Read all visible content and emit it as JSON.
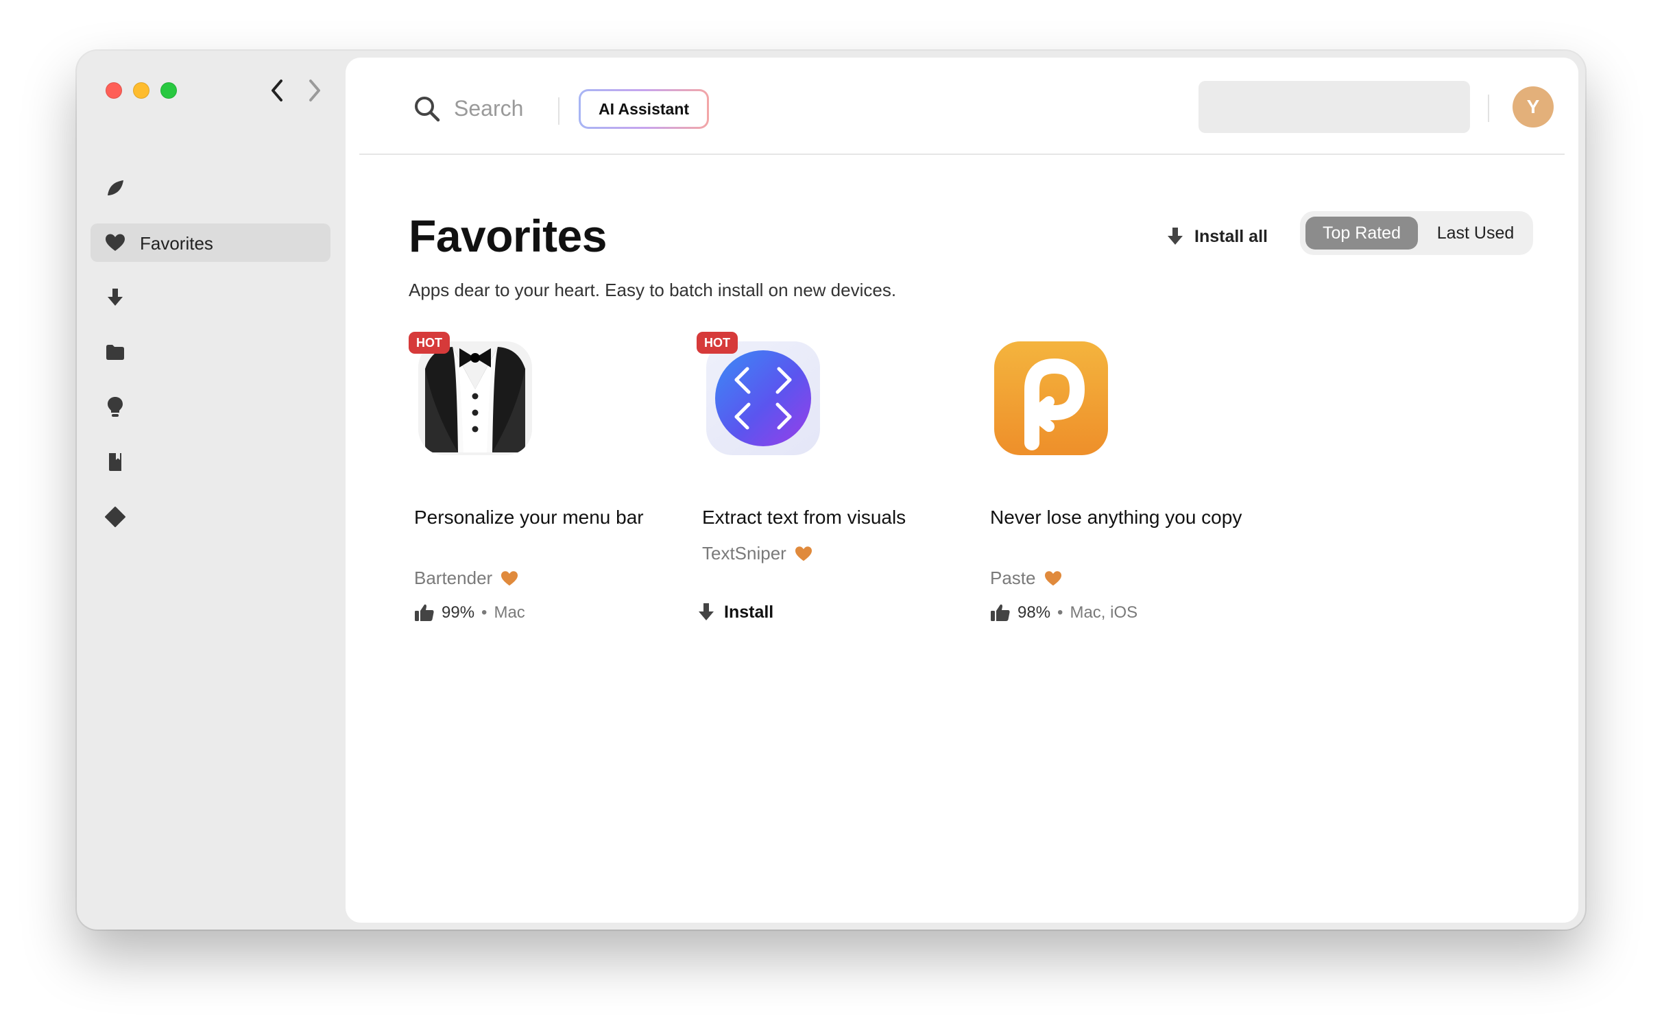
{
  "sidebar": {
    "items": [
      {
        "icon": "leaf-icon"
      },
      {
        "icon": "heart-icon",
        "label": "Favorites",
        "active": true
      },
      {
        "icon": "download-icon"
      },
      {
        "icon": "folder-icon"
      },
      {
        "icon": "lightbulb-icon"
      },
      {
        "icon": "book-icon"
      },
      {
        "icon": "diamond-icon"
      }
    ]
  },
  "topbar": {
    "search_placeholder": "Search",
    "ai_button": "AI Assistant",
    "avatar_initial": "Y"
  },
  "page": {
    "title": "Favorites",
    "subtitle": "Apps dear to your heart. Easy to batch install on new devices.",
    "install_all": "Install all",
    "sort_options": [
      "Top Rated",
      "Last Used"
    ],
    "sort_selected": "Top Rated"
  },
  "apps": [
    {
      "badge": "HOT",
      "title": "Personalize your menu bar",
      "name": "Bartender",
      "rating": "99%",
      "platforms": "Mac",
      "icon": "bartender-tuxedo-icon"
    },
    {
      "badge": "HOT",
      "title": "Extract text from visuals",
      "name": "TextSniper",
      "action": "Install",
      "icon": "textsniper-icon"
    },
    {
      "badge": "",
      "title": "Never lose anything you copy",
      "name": "Paste",
      "rating": "98%",
      "platforms": "Mac, iOS",
      "icon": "paste-icon"
    }
  ],
  "colors": {
    "heart": "#e08a3c",
    "hot_badge": "#d63a3a",
    "segment_active": "#8c8c8c",
    "avatar": "#e3b07a"
  }
}
